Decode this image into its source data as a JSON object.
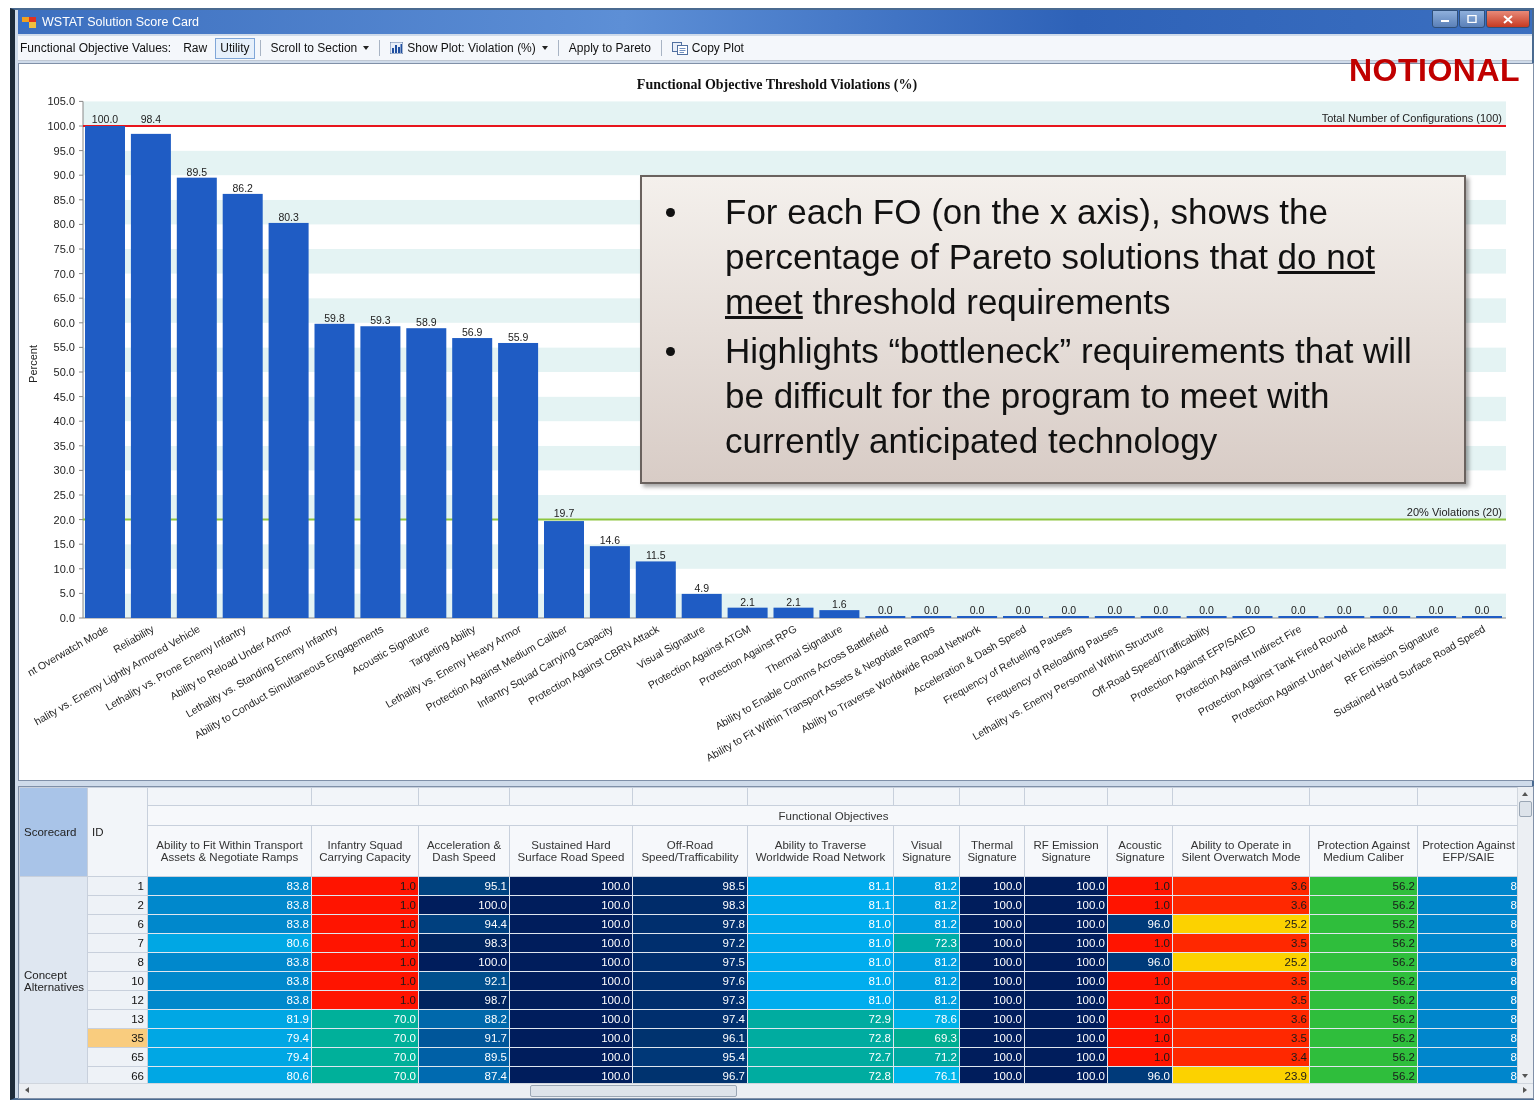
{
  "window": {
    "title": "WSTAT Solution Score Card"
  },
  "toolbar": {
    "label": "Functional Objective Values:",
    "value_modes": [
      {
        "label": "Raw",
        "selected": false
      },
      {
        "label": "Utility",
        "selected": true
      }
    ],
    "items": [
      {
        "kind": "dropdown",
        "label": "Scroll to Section"
      },
      {
        "kind": "plot-dropdown",
        "label": "Show Plot: Violation (%)"
      },
      {
        "kind": "button",
        "label": "Apply to Pareto"
      },
      {
        "kind": "copy-button",
        "label": "Copy Plot"
      }
    ]
  },
  "stamp": "NOTIONAL",
  "chart": {
    "chart_data": {
      "type": "bar",
      "title": "Functional Objective Threshold Violations (%)",
      "ylabel": "Percent",
      "categories": [
        "nt Overwatch Mode",
        "Reliability",
        "hality vs. Enemy Lightly Armored Vehicle",
        "Lethality vs. Prone Enemy Infantry",
        "Ability to Reload Under Armor",
        "Lethality vs. Standing Enemy Infantry",
        "Ability to Conduct Simultaneous Engagements",
        "Acoustic Signature",
        "Targeting Ability",
        "Lethality vs. Enemy Heavy Armor",
        "Protection Against Medium Caliber",
        "Infantry Squad Carrying Capacity",
        "Protection Against CBRN Attack",
        "Visual Signature",
        "Protection Against ATGM",
        "Protection Against RPG",
        "Thermal Signature",
        "Ability to Enable Comms Across Battlefield",
        "Ability to Fit Within Transport Assets & Negotiate Ramps",
        "Ability to Traverse Worldwide Road Network",
        "Acceleration & Dash Speed",
        "Frequency of Refueling Pauses",
        "Frequency of Reloading Pauses",
        "Lethality vs. Enemy Personnel Within Structure",
        "Off-Road Speed/Trafficability",
        "Protection Against EFP/SAIED",
        "Protection Against Indirect Fire",
        "Protection Against Tank Fired Round",
        "Protection Against Under Vehicle Attack",
        "RF Emission Signature",
        "Sustained Hard Surface Road Speed"
      ],
      "values": [
        100.0,
        98.4,
        89.5,
        86.2,
        80.3,
        59.8,
        59.3,
        58.9,
        56.9,
        55.9,
        19.7,
        14.6,
        11.5,
        4.9,
        2.1,
        2.1,
        1.6,
        0,
        0,
        0,
        0,
        0,
        0,
        0,
        0,
        0,
        0,
        0,
        0,
        0,
        0
      ],
      "ylim": [
        0,
        105
      ],
      "yticks": [
        {
          "value": 0,
          "label": "0.0"
        },
        {
          "value": 5,
          "label": "5.0"
        },
        {
          "value": 10,
          "label": "10.0"
        },
        {
          "value": 15,
          "label": "15.0"
        },
        {
          "value": 20,
          "label": "20.0"
        },
        {
          "value": 25,
          "label": "25.0"
        },
        {
          "value": 30,
          "label": "30.0"
        },
        {
          "value": 35,
          "label": "35.0"
        },
        {
          "value": 40,
          "label": "40.0"
        },
        {
          "value": 45,
          "label": "45.0"
        },
        {
          "value": 50,
          "label": "50.0"
        },
        {
          "value": 55,
          "label": "55.0"
        },
        {
          "value": 60,
          "label": "60.0"
        },
        {
          "value": 65,
          "label": "65.0"
        },
        {
          "value": 70,
          "label": "70.0"
        },
        {
          "value": 75,
          "label": "75.0"
        },
        {
          "value": 80,
          "label": "80.0"
        },
        {
          "value": 85,
          "label": "85.0"
        },
        {
          "value": 90,
          "label": "90.0"
        },
        {
          "value": 95,
          "label": "95.0"
        },
        {
          "value": 100,
          "label": "100.0"
        },
        {
          "value": 105,
          "label": "105.0"
        }
      ],
      "value_labels": [
        "100.0",
        "98.4",
        "89.5",
        "86.2",
        "80.3",
        "59.8",
        "59.3",
        "58.9",
        "56.9",
        "55.9",
        "19.7",
        "14.6",
        "11.5",
        "4.9",
        "2.1",
        "2.1",
        "1.6",
        "0.0",
        "0.0",
        "0.0",
        "0.0",
        "0.0",
        "0.0",
        "0.0",
        "0.0",
        "0.0",
        "0.0",
        "0.0",
        "0.0",
        "0.0",
        "0.0"
      ],
      "ref_lines": [
        {
          "axis": "y",
          "value": 100,
          "label": "Total Number of Configurations (100)",
          "color": "#e8141c"
        },
        {
          "axis": "y",
          "value": 20,
          "label": "20% Violations (20)",
          "color": "#8dc63f"
        }
      ]
    }
  },
  "callout": {
    "bullets": [
      [
        {
          "text": "For each FO (on the x axis), shows the percentage of Pareto solutions that ",
          "underline": false
        },
        {
          "text": "do not meet",
          "underline": true
        },
        {
          "text": " threshold requirements",
          "underline": false
        }
      ],
      [
        {
          "text": "Highlights “bottleneck” requirements that will be difficult for the program to meet with currently anticipated technology",
          "underline": false
        }
      ]
    ]
  },
  "table": {
    "corner": "Scorecard",
    "id_header": "ID",
    "group_header": "Functional Objectives",
    "columns": [
      "Ability to Fit Within Transport Assets & Negotiate Ramps",
      "Infantry Squad Carrying Capacity",
      "Acceleration & Dash Speed",
      "Sustained Hard Surface Road Speed",
      "Off-Road Speed/Trafficability",
      "Ability to Traverse Worldwide Road Network",
      "Visual Signature",
      "Thermal Signature",
      "RF Emission Signature",
      "Acoustic Signature",
      "Ability to Operate in Silent Overwatch Mode",
      "Protection Against Medium Caliber",
      "Protection Against EFP/SAIE"
    ],
    "row_group": "Concept Alternatives",
    "rows": [
      {
        "id": "1",
        "selected": false,
        "cells": [
          {
            "value": "83.8",
            "color": "#0088cc"
          },
          {
            "value": "1.0",
            "color": "#ff1400"
          },
          {
            "value": "95.1",
            "color": "#00427f"
          },
          {
            "value": "100.0",
            "color": "#001d5c"
          },
          {
            "value": "98.5",
            "color": "#002c6a"
          },
          {
            "value": "81.1",
            "color": "#00adee"
          },
          {
            "value": "81.2",
            "color": "#009fe0"
          },
          {
            "value": "100.0",
            "color": "#001d5c"
          },
          {
            "value": "100.0",
            "color": "#001d5c"
          },
          {
            "value": "1.0",
            "color": "#ff1400"
          },
          {
            "value": "3.6",
            "color": "#ff2800"
          },
          {
            "value": "56.2",
            "color": "#2fbe3c"
          },
          {
            "value": "8",
            "color": "#0086cc"
          }
        ]
      },
      {
        "id": "2",
        "selected": false,
        "cells": [
          {
            "value": "83.8",
            "color": "#0088cc"
          },
          {
            "value": "1.0",
            "color": "#ff1400"
          },
          {
            "value": "100.0",
            "color": "#001d5c"
          },
          {
            "value": "100.0",
            "color": "#001d5c"
          },
          {
            "value": "98.3",
            "color": "#002c6a"
          },
          {
            "value": "81.1",
            "color": "#00adee"
          },
          {
            "value": "81.2",
            "color": "#009fe0"
          },
          {
            "value": "100.0",
            "color": "#001d5c"
          },
          {
            "value": "100.0",
            "color": "#001d5c"
          },
          {
            "value": "1.0",
            "color": "#ff1400"
          },
          {
            "value": "3.6",
            "color": "#ff2800"
          },
          {
            "value": "56.2",
            "color": "#2fbe3c"
          },
          {
            "value": "8",
            "color": "#0086cc"
          }
        ]
      },
      {
        "id": "6",
        "selected": false,
        "cells": [
          {
            "value": "83.8",
            "color": "#0088cc"
          },
          {
            "value": "1.0",
            "color": "#ff1400"
          },
          {
            "value": "94.4",
            "color": "#00407f"
          },
          {
            "value": "100.0",
            "color": "#001d5c"
          },
          {
            "value": "97.8",
            "color": "#002f6e"
          },
          {
            "value": "81.0",
            "color": "#00adee"
          },
          {
            "value": "81.2",
            "color": "#009fe0"
          },
          {
            "value": "100.0",
            "color": "#001d5c"
          },
          {
            "value": "100.0",
            "color": "#001d5c"
          },
          {
            "value": "96.0",
            "color": "#003a7a"
          },
          {
            "value": "25.2",
            "color": "#fcd200"
          },
          {
            "value": "56.2",
            "color": "#2fbe3c"
          },
          {
            "value": "8",
            "color": "#0086cc"
          }
        ]
      },
      {
        "id": "7",
        "selected": false,
        "cells": [
          {
            "value": "80.6",
            "color": "#00a7e4"
          },
          {
            "value": "1.0",
            "color": "#ff1400"
          },
          {
            "value": "98.3",
            "color": "#00245f"
          },
          {
            "value": "100.0",
            "color": "#001d5c"
          },
          {
            "value": "97.2",
            "color": "#002f6e"
          },
          {
            "value": "81.0",
            "color": "#00adee"
          },
          {
            "value": "72.3",
            "color": "#00aca6"
          },
          {
            "value": "100.0",
            "color": "#001d5c"
          },
          {
            "value": "100.0",
            "color": "#001d5c"
          },
          {
            "value": "1.0",
            "color": "#ff1400"
          },
          {
            "value": "3.5",
            "color": "#ff2800"
          },
          {
            "value": "56.2",
            "color": "#2fbe3c"
          },
          {
            "value": "8",
            "color": "#0086cc"
          }
        ]
      },
      {
        "id": "8",
        "selected": false,
        "cells": [
          {
            "value": "83.8",
            "color": "#0088cc"
          },
          {
            "value": "1.0",
            "color": "#ff1400"
          },
          {
            "value": "100.0",
            "color": "#001d5c"
          },
          {
            "value": "100.0",
            "color": "#001d5c"
          },
          {
            "value": "97.5",
            "color": "#002f6e"
          },
          {
            "value": "81.0",
            "color": "#00adee"
          },
          {
            "value": "81.2",
            "color": "#009fe0"
          },
          {
            "value": "100.0",
            "color": "#001d5c"
          },
          {
            "value": "100.0",
            "color": "#001d5c"
          },
          {
            "value": "96.0",
            "color": "#003a7a"
          },
          {
            "value": "25.2",
            "color": "#fcd200"
          },
          {
            "value": "56.2",
            "color": "#2fbe3c"
          },
          {
            "value": "8",
            "color": "#0086cc"
          }
        ]
      },
      {
        "id": "10",
        "selected": false,
        "cells": [
          {
            "value": "83.8",
            "color": "#0088cc"
          },
          {
            "value": "1.0",
            "color": "#ff1400"
          },
          {
            "value": "92.1",
            "color": "#004f8d"
          },
          {
            "value": "100.0",
            "color": "#001d5c"
          },
          {
            "value": "97.6",
            "color": "#002f6e"
          },
          {
            "value": "81.0",
            "color": "#00adee"
          },
          {
            "value": "81.2",
            "color": "#009fe0"
          },
          {
            "value": "100.0",
            "color": "#001d5c"
          },
          {
            "value": "100.0",
            "color": "#001d5c"
          },
          {
            "value": "1.0",
            "color": "#ff1400"
          },
          {
            "value": "3.5",
            "color": "#ff2800"
          },
          {
            "value": "56.2",
            "color": "#2fbe3c"
          },
          {
            "value": "8",
            "color": "#0086cc"
          }
        ]
      },
      {
        "id": "12",
        "selected": false,
        "cells": [
          {
            "value": "83.8",
            "color": "#0088cc"
          },
          {
            "value": "1.0",
            "color": "#ff1400"
          },
          {
            "value": "98.7",
            "color": "#00235e"
          },
          {
            "value": "100.0",
            "color": "#001d5c"
          },
          {
            "value": "97.3",
            "color": "#002f6e"
          },
          {
            "value": "81.0",
            "color": "#00adee"
          },
          {
            "value": "81.2",
            "color": "#009fe0"
          },
          {
            "value": "100.0",
            "color": "#001d5c"
          },
          {
            "value": "100.0",
            "color": "#001d5c"
          },
          {
            "value": "1.0",
            "color": "#ff1400"
          },
          {
            "value": "3.5",
            "color": "#ff2800"
          },
          {
            "value": "56.2",
            "color": "#2fbe3c"
          },
          {
            "value": "8",
            "color": "#0086cc"
          }
        ]
      },
      {
        "id": "13",
        "selected": false,
        "cells": [
          {
            "value": "81.9",
            "color": "#00a7e4"
          },
          {
            "value": "70.0",
            "color": "#00b09a"
          },
          {
            "value": "88.2",
            "color": "#0068ab"
          },
          {
            "value": "100.0",
            "color": "#001d5c"
          },
          {
            "value": "97.4",
            "color": "#002f6e"
          },
          {
            "value": "72.9",
            "color": "#00aca0"
          },
          {
            "value": "78.6",
            "color": "#00b2e8"
          },
          {
            "value": "100.0",
            "color": "#001d5c"
          },
          {
            "value": "100.0",
            "color": "#001d5c"
          },
          {
            "value": "1.0",
            "color": "#ff1400"
          },
          {
            "value": "3.6",
            "color": "#ff2800"
          },
          {
            "value": "56.2",
            "color": "#2fbe3c"
          },
          {
            "value": "8",
            "color": "#0086cc"
          }
        ]
      },
      {
        "id": "35",
        "selected": true,
        "cells": [
          {
            "value": "79.4",
            "color": "#00a7e4"
          },
          {
            "value": "70.0",
            "color": "#00b09a"
          },
          {
            "value": "91.7",
            "color": "#00569a"
          },
          {
            "value": "100.0",
            "color": "#001d5c"
          },
          {
            "value": "96.1",
            "color": "#00336f"
          },
          {
            "value": "72.8",
            "color": "#00aca0"
          },
          {
            "value": "69.3",
            "color": "#00ae92"
          },
          {
            "value": "100.0",
            "color": "#001d5c"
          },
          {
            "value": "100.0",
            "color": "#001d5c"
          },
          {
            "value": "1.0",
            "color": "#ff1400"
          },
          {
            "value": "3.5",
            "color": "#ff2800"
          },
          {
            "value": "56.2",
            "color": "#2fbe3c"
          },
          {
            "value": "8",
            "color": "#0086cc"
          }
        ]
      },
      {
        "id": "65",
        "selected": false,
        "cells": [
          {
            "value": "79.4",
            "color": "#00a7e4"
          },
          {
            "value": "70.0",
            "color": "#00b09a"
          },
          {
            "value": "89.5",
            "color": "#0060a6"
          },
          {
            "value": "100.0",
            "color": "#001d5c"
          },
          {
            "value": "95.4",
            "color": "#003878"
          },
          {
            "value": "72.7",
            "color": "#00aca0"
          },
          {
            "value": "71.2",
            "color": "#00aaa2"
          },
          {
            "value": "100.0",
            "color": "#001d5c"
          },
          {
            "value": "100.0",
            "color": "#001d5c"
          },
          {
            "value": "1.0",
            "color": "#ff1400"
          },
          {
            "value": "3.4",
            "color": "#ff2800"
          },
          {
            "value": "56.2",
            "color": "#2fbe3c"
          },
          {
            "value": "8",
            "color": "#0086cc"
          }
        ]
      },
      {
        "id": "66",
        "selected": false,
        "cells": [
          {
            "value": "80.6",
            "color": "#00a7e4"
          },
          {
            "value": "70.0",
            "color": "#00b09a"
          },
          {
            "value": "87.4",
            "color": "#006ab0"
          },
          {
            "value": "100.0",
            "color": "#001d5c"
          },
          {
            "value": "96.7",
            "color": "#00336f"
          },
          {
            "value": "72.8",
            "color": "#00aca0"
          },
          {
            "value": "76.1",
            "color": "#00b6ea"
          },
          {
            "value": "100.0",
            "color": "#001d5c"
          },
          {
            "value": "100.0",
            "color": "#001d5c"
          },
          {
            "value": "96.0",
            "color": "#003a7a"
          },
          {
            "value": "23.9",
            "color": "#fcd200"
          },
          {
            "value": "56.2",
            "color": "#2fbe3c"
          },
          {
            "value": "8",
            "color": "#0086cc"
          }
        ]
      }
    ]
  }
}
